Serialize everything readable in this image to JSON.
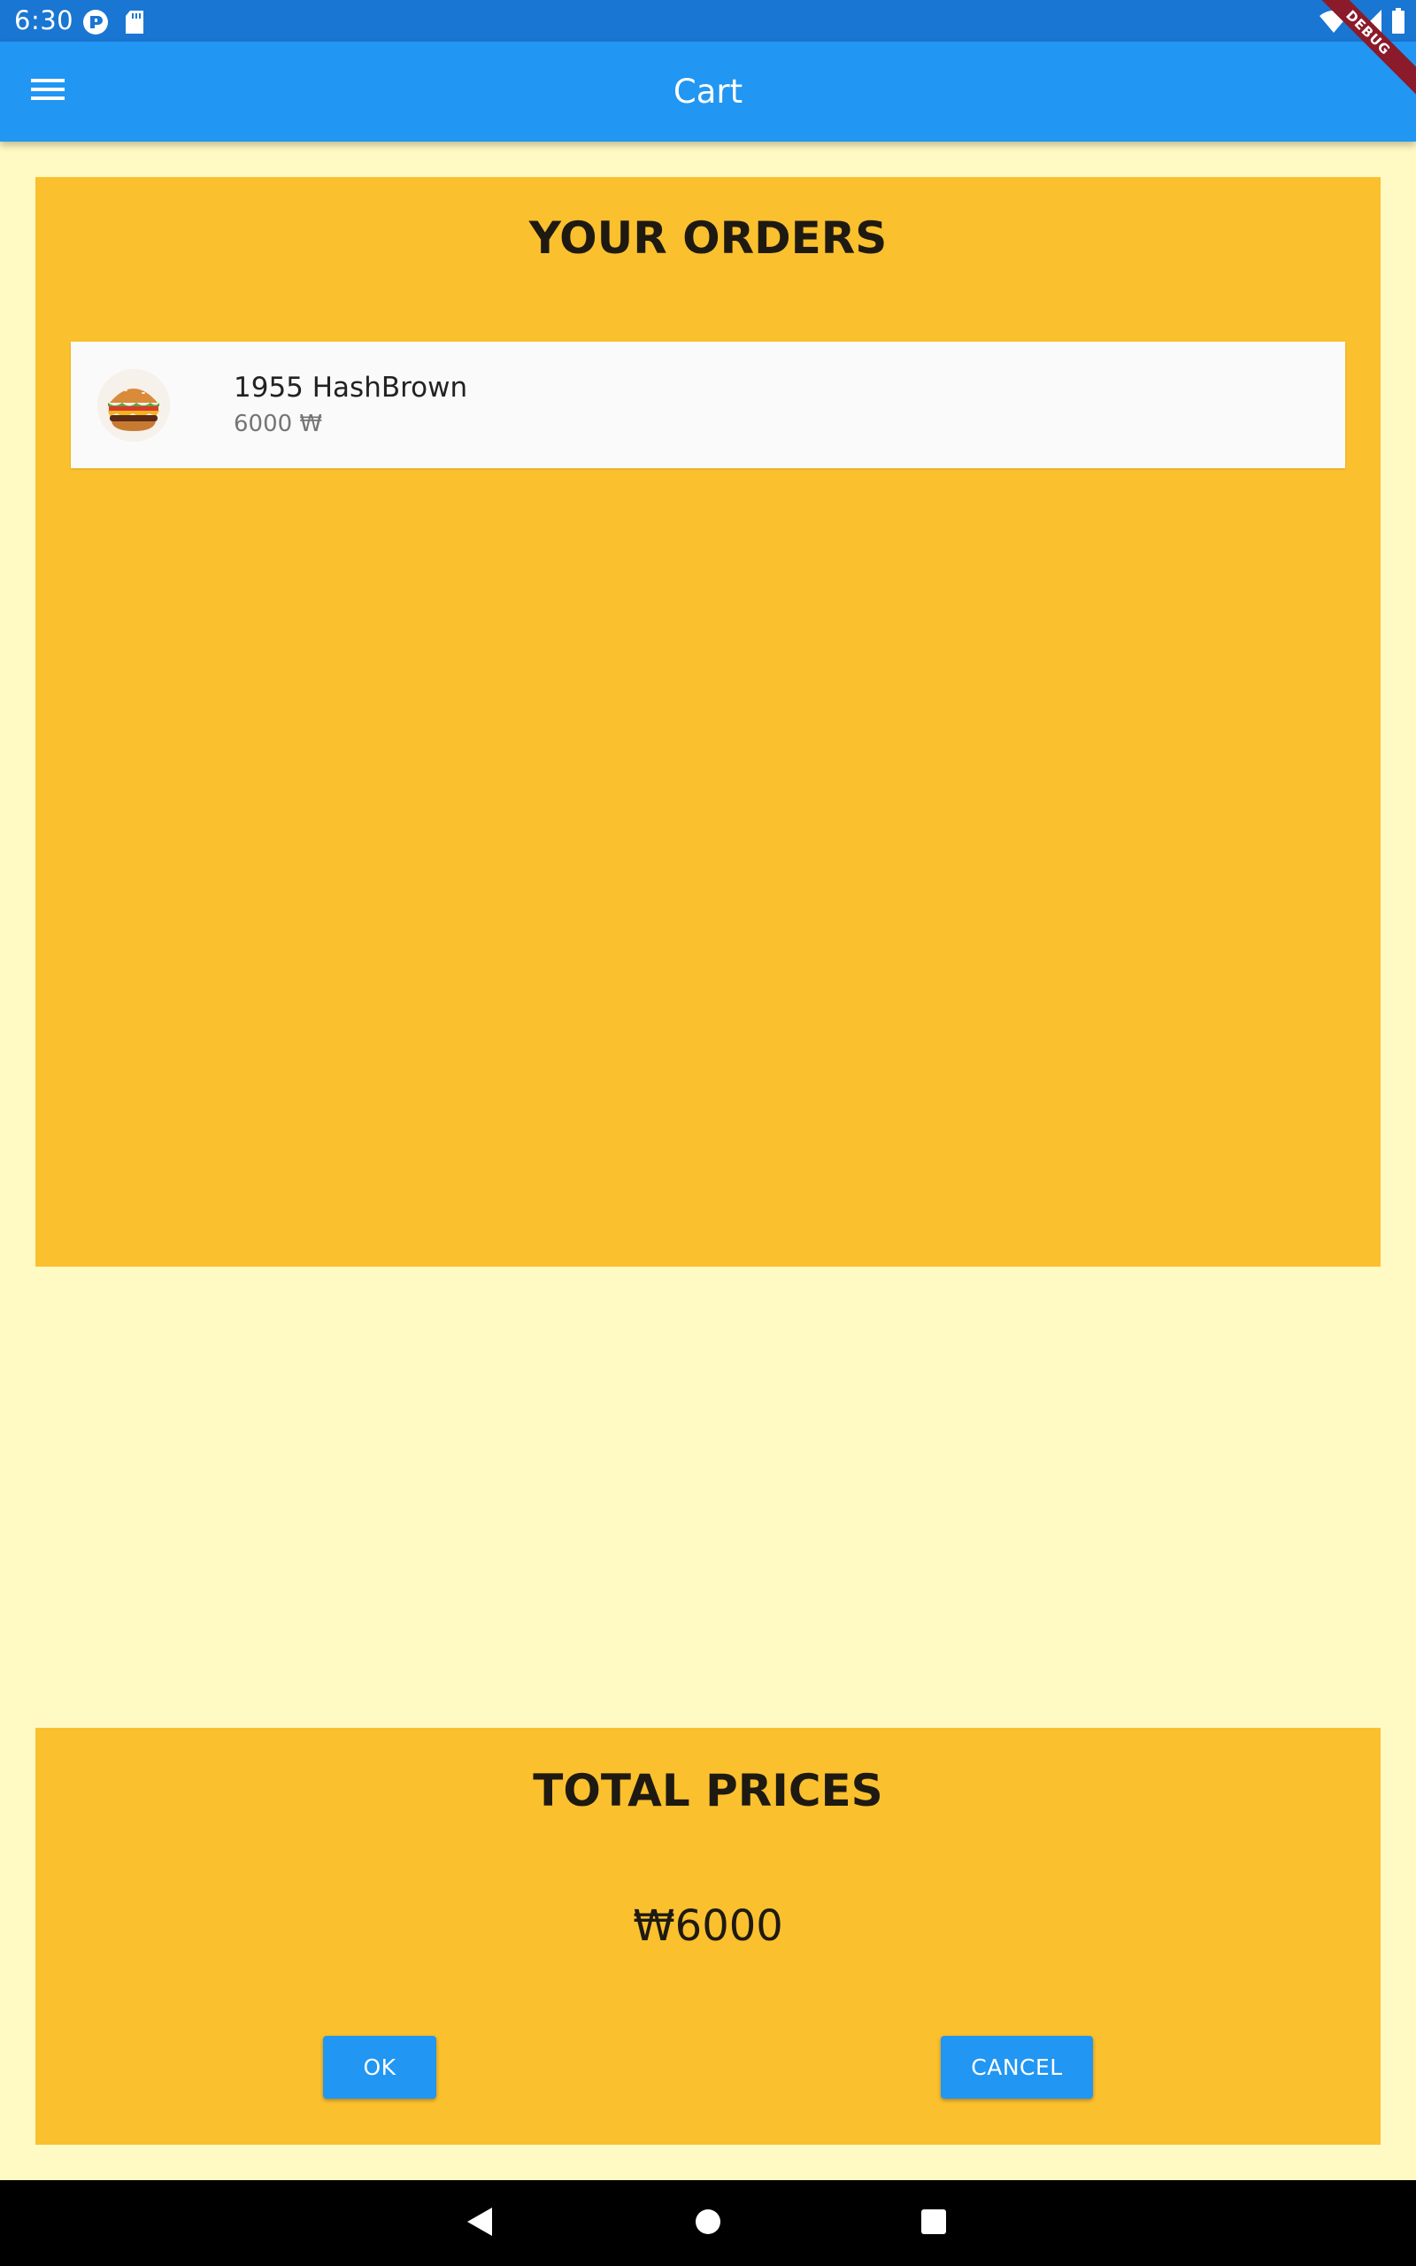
{
  "status_bar": {
    "time": "6:30",
    "left_icons": [
      "notification-app-icon",
      "sd-card-icon"
    ],
    "right_icons": [
      "wifi-icon",
      "cell-signal-icon",
      "battery-icon"
    ]
  },
  "app_bar": {
    "title": "Cart",
    "menu_icon": "hamburger-menu-icon",
    "debug_banner": "DEBUG"
  },
  "orders": {
    "heading": "YOUR ORDERS",
    "items": [
      {
        "name": "1955 HashBrown",
        "price": "6000 ₩",
        "thumbnail_icon": "burger-image"
      }
    ]
  },
  "total": {
    "heading": "TOTAL PRICES",
    "value": "₩6000",
    "ok_label": "OK",
    "cancel_label": "CANCEL"
  },
  "nav_bar": {
    "icons": [
      "back-icon",
      "home-icon",
      "recents-icon"
    ]
  },
  "colors": {
    "status_bar": "#1976D2",
    "app_bar": "#2196F3",
    "page_background": "#FFF9C4",
    "panel": "#FBC02D",
    "button": "#2196F3",
    "item_background": "#FAFAFA"
  }
}
